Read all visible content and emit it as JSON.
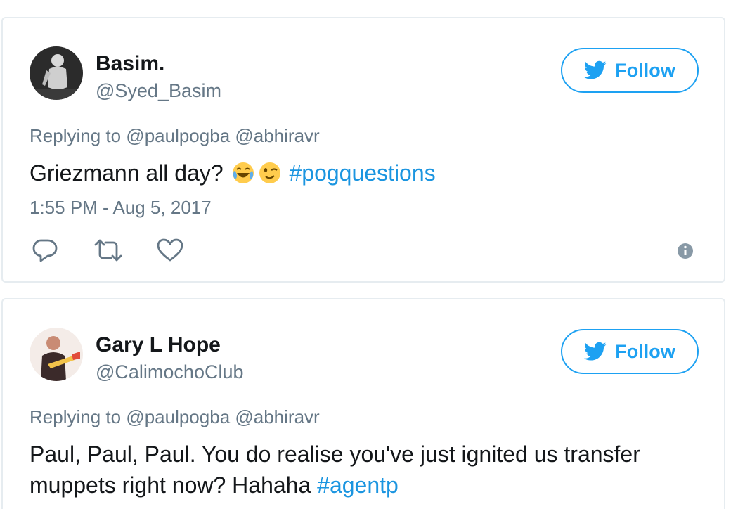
{
  "tweets": [
    {
      "name": "Basim.",
      "handle": "@Syed_Basim",
      "follow_label": "Follow",
      "replying_to": "Replying to @paulpogba @abhiravr",
      "text_before": "Griezmann all day? ",
      "emojis": [
        "face-with-tears-of-joy-emoji",
        "winking-face-emoji"
      ],
      "hashtag": "#pogquestions",
      "timestamp": "1:55 PM - Aug 5, 2017",
      "actions": [
        "reply-icon",
        "retweet-icon",
        "like-icon",
        "info-icon"
      ]
    },
    {
      "name": "Gary L Hope",
      "handle": "@CalimochoClub",
      "follow_label": "Follow",
      "replying_to": "Replying to @paulpogba @abhiravr",
      "text_before": "Paul, Paul, Paul. You do realise you've just ignited us transfer muppets right now? Hahaha ",
      "hashtag": "#agentp"
    }
  ],
  "colors": {
    "accent": "#1da1f2",
    "hashtag": "#1b95e0",
    "secondary_text": "#657786",
    "border": "#e6ecf0"
  }
}
